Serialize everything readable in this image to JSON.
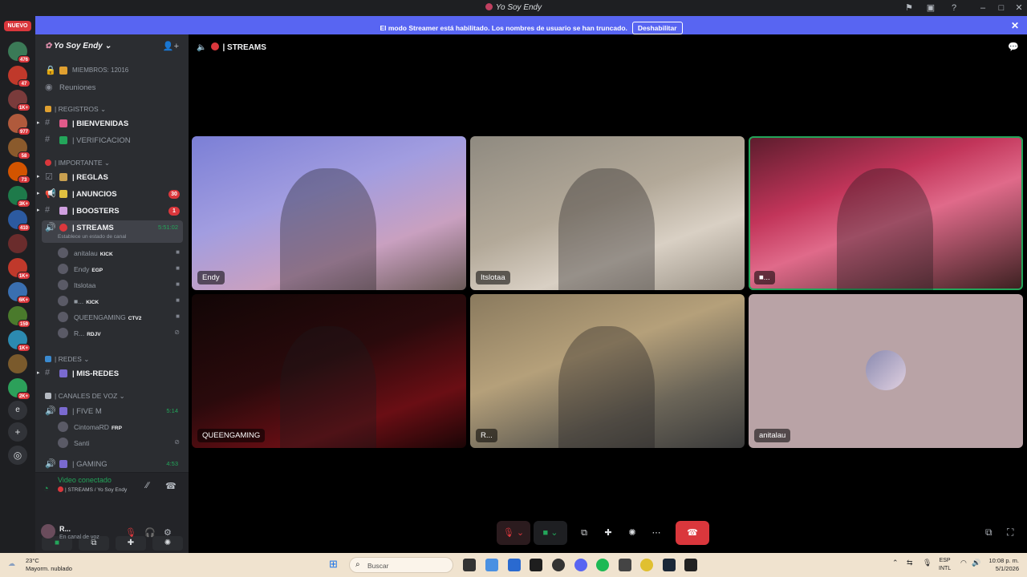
{
  "window": {
    "title": "Yo Soy Endy"
  },
  "banner": {
    "text": "El modo Streamer está habilitado. Los nombres de usuario se han truncado.",
    "button": "Deshabilitar"
  },
  "rail": {
    "nuevo": "NUEVO",
    "servers": [
      {
        "badge": "476",
        "color": "#3b7a57"
      },
      {
        "badge": "47",
        "color": "#c0392b"
      },
      {
        "badge": "1K+",
        "color": "#7a3b3b"
      },
      {
        "badge": "977",
        "color": "#b05a3c"
      },
      {
        "badge": "58",
        "color": "#8a5a2c"
      },
      {
        "badge": "73",
        "color": "#d35400"
      },
      {
        "badge": "3K+",
        "color": "#1e7a4a"
      },
      {
        "badge": "410",
        "color": "#2c5aa0"
      },
      {
        "badge": "",
        "color": "#6a2c2c"
      },
      {
        "badge": "1K+",
        "color": "#c0392b"
      },
      {
        "badge": "6K+",
        "color": "#3a6fb0"
      },
      {
        "badge": "159",
        "color": "#4a7a2c"
      },
      {
        "badge": "1K+",
        "color": "#2c8ab0"
      },
      {
        "badge": "",
        "color": "#7a5a2c"
      },
      {
        "badge": "2K+",
        "color": "#2ca05a"
      }
    ],
    "letter": "e"
  },
  "server": {
    "name": "Yo Soy Endy",
    "members": "MIEMBROS: 12016",
    "meetings": "Reuniones"
  },
  "channels": {
    "cat_registros": "| REGISTROS",
    "bienvenidas": "| BIENVENIDAS",
    "verificacion": "| VERIFICACION",
    "cat_importante": "| IMPORTANTE",
    "reglas": "| REGLAS",
    "anuncios": "| ANUNCIOS",
    "anuncios_count": "30",
    "boosters": "| BOOSTERS",
    "boosters_count": "1",
    "streams": "| STREAMS",
    "streams_time": "5:51:02",
    "streams_status": "Establece un estado de canal",
    "streams_users": [
      {
        "name": "anitalau",
        "tag": "KICK",
        "live": ""
      },
      {
        "name": "Endy",
        "tag": "EGP",
        "live": ""
      },
      {
        "name": "Itslotaa",
        "tag": "",
        "live": ""
      },
      {
        "name": "■...",
        "tag": "KICK",
        "live": ""
      },
      {
        "name": "QUEENGAMING",
        "tag": "CTV2",
        "live": ""
      },
      {
        "name": "R...",
        "tag": "RDJV",
        "live": ""
      }
    ],
    "cat_redes": "| REDES",
    "mis_redes": "| MIS-REDES",
    "cat_voz": "| CANALES DE VOZ",
    "five_m": "| FIVE M",
    "five_m_time": "5:14",
    "five_m_users": [
      {
        "name": "CintomaRD",
        "tag": "FRP"
      },
      {
        "name": "Santi",
        "tag": ""
      }
    ],
    "gaming": "| GAMING",
    "gaming_time": "4:53"
  },
  "voice_panel": {
    "status": "Video conectado",
    "location": "| STREAMS / Yo Soy Endy",
    "user_name": "R...",
    "user_status": "En canal de voz"
  },
  "stage": {
    "channel": "| STREAMS",
    "tiles": [
      {
        "name": "Endy",
        "bg": "linear-gradient(160deg,#7b7fd6 0%,#a29de0 40%,#c9a0c0 70%,#6a5a58 100%)",
        "speaking": false
      },
      {
        "name": "Itslotaa",
        "bg": "linear-gradient(160deg,#8f8a80 0%,#b3a999 45%,#d9d0c4 70%,#9a9286 100%)",
        "speaking": false
      },
      {
        "name": "■...",
        "bg": "linear-gradient(160deg,#5a1c2c 0%,#c2355a 35%,#e06a8a 55%,#3a2020 100%)",
        "speaking": true
      },
      {
        "name": "QUEENGAMING",
        "bg": "linear-gradient(160deg,#120606 0%,#2a0a0c 45%,#6a0e14 75%,#1a0506 100%)",
        "speaking": false
      },
      {
        "name": "R...",
        "bg": "linear-gradient(160deg,#8a7a5e 0%,#b5a07a 40%,#6b6558 70%,#3a3a3a 100%)",
        "speaking": false
      },
      {
        "name": "anitalau",
        "bg": "#b9a3a6",
        "speaking": false
      }
    ]
  },
  "taskbar": {
    "temp": "23°C",
    "weather": "Mayorm. nublado",
    "search": "Buscar",
    "lang_top": "ESP",
    "lang_bottom": "INTL",
    "time": "10:08 p. m.",
    "date": "5/1/2026"
  }
}
